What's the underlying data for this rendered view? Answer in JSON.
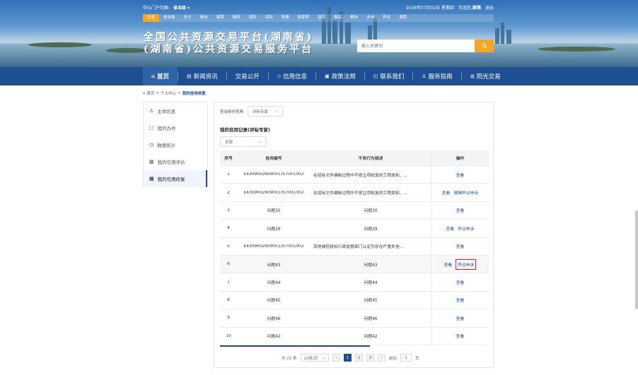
{
  "topbar": {
    "current_label": "中心门户切换:",
    "current_value": "省本级",
    "date": "2026年07月02日 星期四",
    "welcome": "欢迎您,",
    "user": "薛燕",
    "logout": "退出"
  },
  "cities": [
    "全省",
    "省本级",
    "长沙",
    "株洲",
    "湘潭",
    "衡阳",
    "邵阳",
    "岳阳",
    "常德",
    "张家界",
    "益阳",
    "娄底",
    "郴州",
    "永州",
    "怀化",
    "湘西"
  ],
  "header": {
    "title_line1": "全国公共资源交易平台(湖南省)",
    "title_line2": "(湖南省)公共资源交易服务平台",
    "search_placeholder": "输入关键词"
  },
  "nav": [
    "首页",
    "新闻资讯",
    "交易公开",
    "信用信息",
    "政策法规",
    "联系我们",
    "服务指南",
    "阳光交易"
  ],
  "breadcrumb": {
    "home": "首页",
    "mid": "个人中心",
    "current": "我的信用修复"
  },
  "sidebar": [
    "主体信息",
    "我的办件",
    "数据统计",
    "我的信用评价",
    "我的信用修复"
  ],
  "filter": {
    "label": "查询身份视角:",
    "value": "评标专家"
  },
  "record_title": "我的信用记录(评标专家)",
  "scope_select": "全部",
  "table": {
    "headers": [
      "序号",
      "信用编号",
      "不良行为描述",
      "操作"
    ],
    "rows": [
      {
        "no": "1",
        "code": "E4309002609001357001002",
        "desc": "在招标文件编制过程中不按立项批复的工程类别、...",
        "actions": [
          "查看"
        ]
      },
      {
        "no": "2",
        "code": "E4309002609001357001002",
        "desc": "在招标文件编制过程中不按立项批复的工程类别、...",
        "actions": [
          "查看",
          "编辑异议申诉"
        ]
      },
      {
        "no": "3",
        "code": "问题30",
        "desc": "问题30",
        "actions": [
          "查看"
        ]
      },
      {
        "no": "4",
        "code": "问题29",
        "desc": "问题29",
        "actions": [
          "查看",
          "异议申诉"
        ]
      },
      {
        "no": "5",
        "code": "E4309002609001357001002",
        "desc": "其他被招投标行政监督部门认定为存在严重失信...",
        "actions": [
          "查看"
        ]
      },
      {
        "no": "6",
        "code": "问题43",
        "desc": "问题43",
        "actions": [
          "查看",
          "异议申诉"
        ]
      },
      {
        "no": "7",
        "code": "问题44",
        "desc": "问题44",
        "actions": [
          "查看"
        ]
      },
      {
        "no": "8",
        "code": "问题45",
        "desc": "问题45",
        "actions": [
          "查看"
        ]
      },
      {
        "no": "9",
        "code": "问题46",
        "desc": "问题46",
        "actions": [
          "查看"
        ]
      },
      {
        "no": "10",
        "code": "问题42",
        "desc": "问题42",
        "actions": [
          "查看"
        ]
      }
    ]
  },
  "pager": {
    "total": "共 21 条",
    "page_size": "10条/页",
    "pages": [
      "1",
      "2",
      "3"
    ],
    "goto_label": "前往",
    "goto_value": "1",
    "page_unit": "页"
  },
  "colors": {
    "brand": "#1e4f93",
    "accent": "#f5a623",
    "highlight": "#e02020"
  }
}
